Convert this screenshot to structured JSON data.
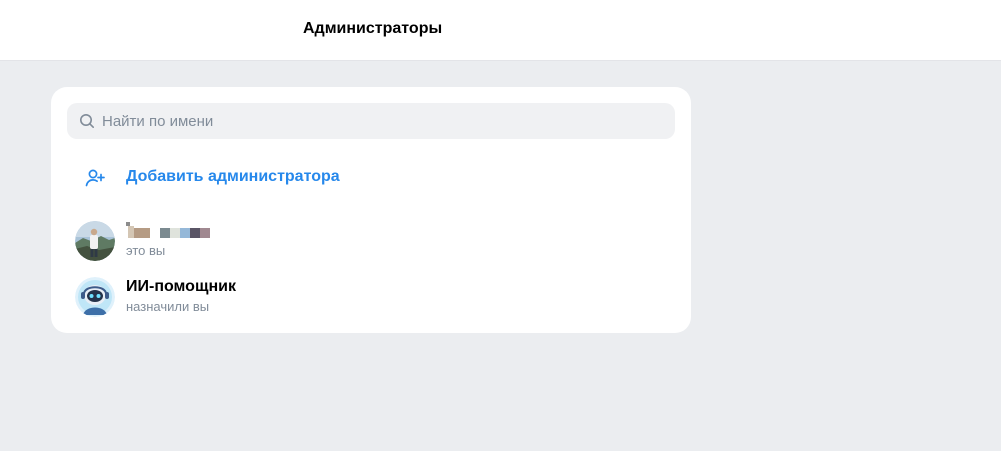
{
  "header": {
    "title": "Администраторы"
  },
  "search": {
    "placeholder": "Найти по имени",
    "icon": "search-icon"
  },
  "add_admin": {
    "label": "Добавить администратора",
    "icon": "add-user-icon",
    "color": "#2688eb"
  },
  "admins": [
    {
      "name": "",
      "subtitle": "это вы",
      "name_obscured": true
    },
    {
      "name": "ИИ-помощник",
      "subtitle": "назначили вы"
    }
  ],
  "colors": {
    "background": "#ebedf0",
    "card": "#ffffff",
    "search_bg": "#f0f1f3",
    "accent": "#2688eb",
    "secondary_text": "#818c99"
  }
}
